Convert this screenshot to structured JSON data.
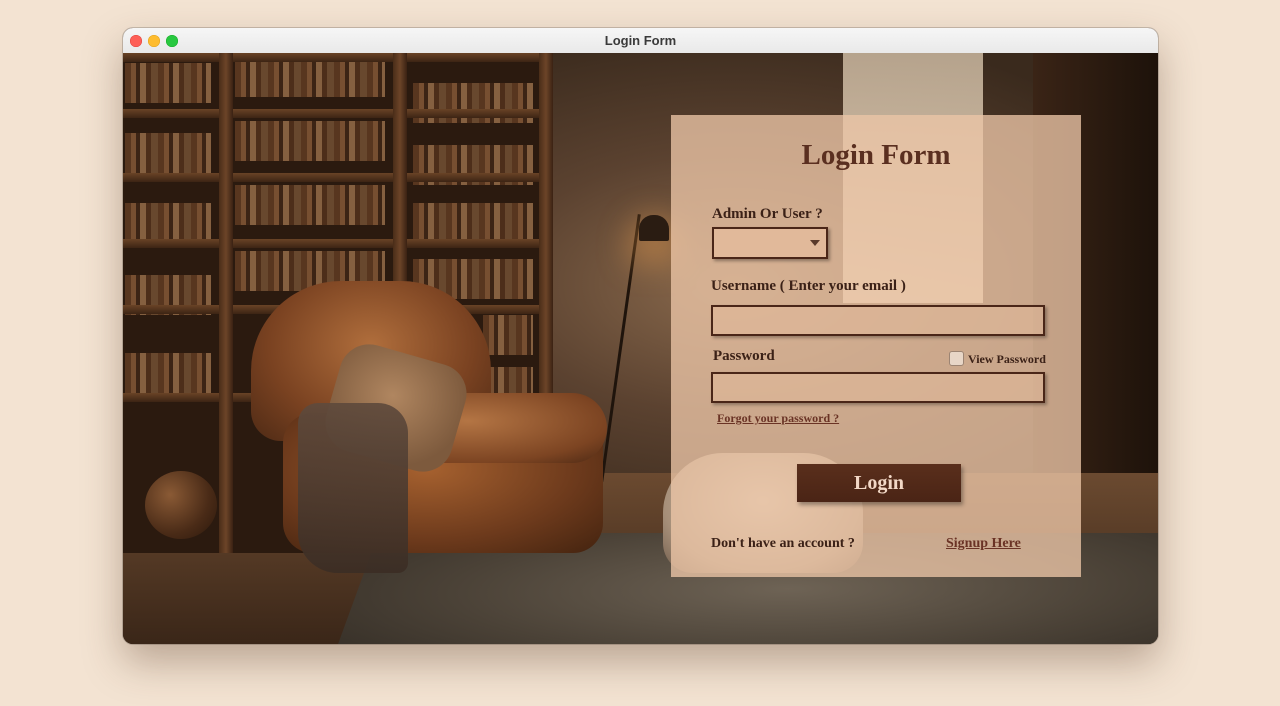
{
  "window": {
    "title": "Login Form"
  },
  "form": {
    "title": "Login Form",
    "role_label": "Admin Or User ?",
    "role_value": "",
    "username_label": "Username ( Enter your email )",
    "username_value": "",
    "password_label": "Password",
    "password_value": "",
    "view_password_label": "View Password",
    "view_password_checked": false,
    "forgot_link": "Forgot your password ?",
    "login_button": "Login",
    "no_account_text": "Don't have an account ?",
    "signup_link": "Signup Here"
  },
  "colors": {
    "background": "#f3e3d2",
    "panel": "#ecc5a6",
    "accent": "#5a2f1c",
    "text": "#3b2117"
  }
}
